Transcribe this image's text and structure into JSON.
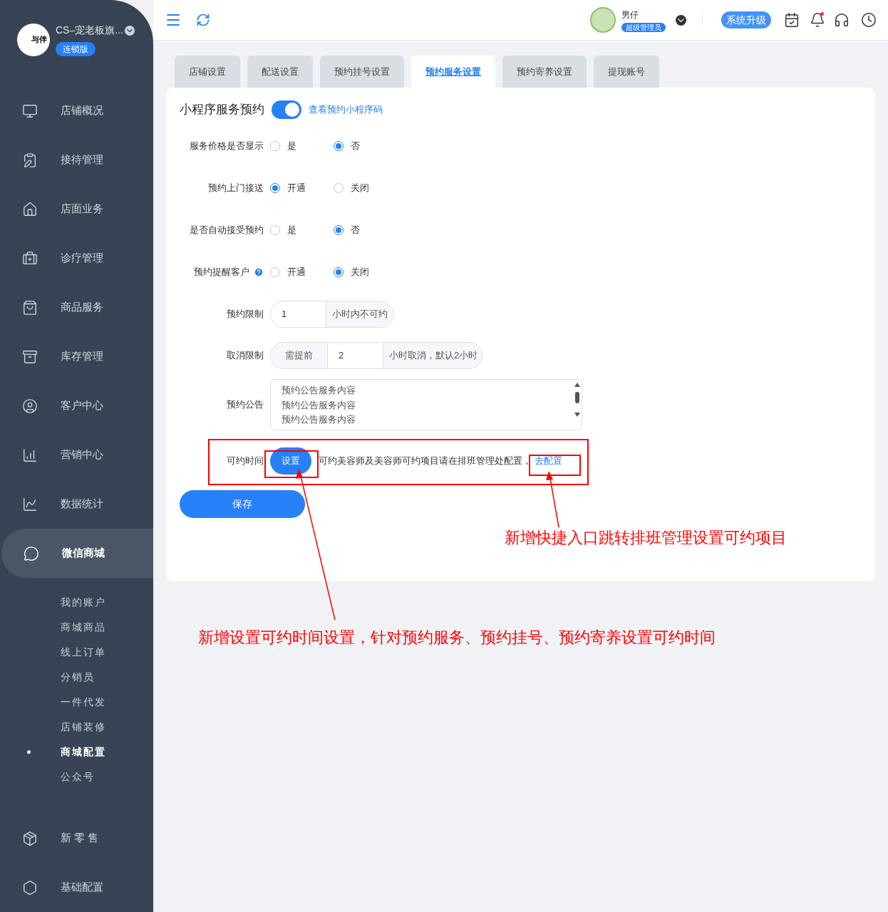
{
  "sidebar": {
    "logo_text": "与伴",
    "store_name": "CS–宠老板旗...",
    "edition": "连锁版",
    "menu": [
      {
        "label": "店铺概况",
        "selected": false
      },
      {
        "label": "接待管理",
        "selected": false
      },
      {
        "label": "店面业务",
        "selected": false
      },
      {
        "label": "诊疗管理",
        "selected": false
      },
      {
        "label": "商品服务",
        "selected": false
      },
      {
        "label": "库存管理",
        "selected": false
      },
      {
        "label": "客户中心",
        "selected": false
      },
      {
        "label": "营销中心",
        "selected": false
      },
      {
        "label": "数据统计",
        "selected": false
      },
      {
        "label": "微信商城",
        "selected": true,
        "children": [
          {
            "label": "我的账户",
            "selected": false
          },
          {
            "label": "商城商品",
            "selected": false
          },
          {
            "label": "线上订单",
            "selected": false
          },
          {
            "label": "分销员",
            "selected": false
          },
          {
            "label": "一件代发",
            "selected": false
          },
          {
            "label": "店铺装修",
            "selected": false
          },
          {
            "label": "商城配置",
            "selected": true
          },
          {
            "label": "公众号",
            "selected": false
          }
        ]
      },
      {
        "label": "新 零 售",
        "selected": false
      },
      {
        "label": "基础配置",
        "selected": false
      }
    ]
  },
  "header": {
    "user_name": "男仔",
    "role": "超级管理员",
    "upgrade": "系统升级",
    "notification_dot": true
  },
  "tabs": [
    {
      "label": "店铺设置",
      "selected": false
    },
    {
      "label": "配送设置",
      "selected": false
    },
    {
      "label": "预约挂号设置",
      "selected": false
    },
    {
      "label": "预约服务设置",
      "selected": true
    },
    {
      "label": "预约寄养设置",
      "selected": false
    },
    {
      "label": "提现账号",
      "selected": false
    }
  ],
  "form": {
    "toggle": {
      "label": "小程序服务预约",
      "on": true,
      "link": "查看预约小程序码"
    },
    "radio_groups": [
      {
        "label": "服务价格是否显示",
        "options": [
          {
            "label": "是",
            "selected": false
          },
          {
            "label": "否",
            "selected": true
          }
        ]
      },
      {
        "label": "预约上门接送",
        "options": [
          {
            "label": "开通",
            "selected": true
          },
          {
            "label": "关闭",
            "selected": false
          }
        ]
      },
      {
        "label": "是否自动接受预约",
        "options": [
          {
            "label": "是",
            "selected": false
          },
          {
            "label": "否",
            "selected": true
          }
        ]
      },
      {
        "label": "预约提醒客户",
        "help": true,
        "options": [
          {
            "label": "开通",
            "selected": false
          },
          {
            "label": "关闭",
            "selected": true
          }
        ]
      }
    ],
    "booking_limit": {
      "label": "预约限制",
      "value": "1",
      "suffix": "小时内不可约"
    },
    "cancel_limit": {
      "label": "取消限制",
      "prefix": "需提前",
      "value": "2",
      "suffix": "小时取消，默认2小时"
    },
    "notice": {
      "label": "预约公告",
      "lines": [
        "预约公告服务内容",
        "预约公告服务内容",
        "预约公告服务内容"
      ]
    },
    "available_time": {
      "label": "可约时间",
      "button": "设置",
      "note": "可约美容师及美容师可约项目请在排班管理处配置，",
      "link": "去配置"
    },
    "save": "保存"
  },
  "annotations": [
    "新增快捷入口跳转排班管理设置可约项目",
    "新增设置可约时间设置，针对预约服务、预约挂号、预约寄养设置可约时间"
  ]
}
